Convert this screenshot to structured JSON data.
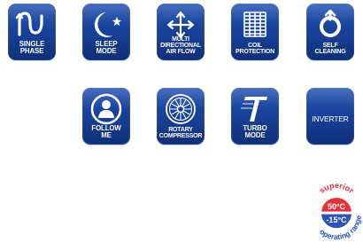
{
  "features": {
    "single_phase": {
      "label": "SINGLE\nPHASE",
      "icon": "sine-wave-icon"
    },
    "sleep_mode": {
      "label": "SLEEP\nMODE",
      "icon": "moon-star-icon"
    },
    "multi_airflow": {
      "label": "MULTI\nDIRECTIONAL\nAIR FLOW",
      "icon": "four-arrows-icon"
    },
    "coil_protection": {
      "label": "COIL\nPROTECTION",
      "icon": "coil-grid-icon"
    },
    "self_cleaning": {
      "label": "SELF\nCLEANING",
      "icon": "circle-arrow-icon"
    },
    "follow_me": {
      "label": "FOLLOW\nME",
      "icon": "person-icon"
    },
    "rotary_compressor": {
      "label": "ROTARY\nCOMPRESSOR",
      "icon": "rotor-icon"
    },
    "turbo_mode": {
      "label": "TURBO\nMODE",
      "icon": "turbo-t-icon"
    },
    "inverter": {
      "label": "INVERTER",
      "icon": "inverter-text-icon"
    }
  },
  "badge": {
    "top_text": "superior",
    "bottom_text": "operating range",
    "high_temp": "50°C",
    "low_temp": "-15°C"
  },
  "colors": {
    "tile_blue": "#1a4aa8",
    "tile_dark": "#0f2f78",
    "badge_red": "#e2313b",
    "badge_blue": "#2a54b5"
  }
}
